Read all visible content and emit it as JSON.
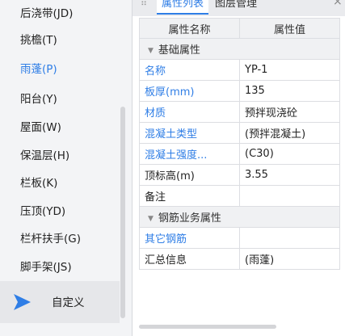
{
  "sidebar": {
    "items": [
      {
        "label": "后浇带(JD)",
        "active": false
      },
      {
        "label": "挑檐(T)",
        "active": false
      },
      {
        "label": "雨蓬(P)",
        "active": true
      },
      {
        "label": "阳台(Y)",
        "active": false
      },
      {
        "label": "屋面(W)",
        "active": false
      },
      {
        "label": "保温层(H)",
        "active": false
      },
      {
        "label": "栏板(K)",
        "active": false
      },
      {
        "label": "压顶(YD)",
        "active": false
      },
      {
        "label": "栏杆扶手(G)",
        "active": false
      },
      {
        "label": "脚手架(JS)",
        "active": false
      }
    ],
    "custom": {
      "label": "自定义",
      "icon": "play-icon"
    }
  },
  "panel": {
    "grip": "⠿",
    "tabs": [
      {
        "label": "属性列表",
        "active": true
      },
      {
        "label": "图层管理",
        "active": false
      }
    ],
    "close": "×",
    "table": {
      "headers": [
        "属性名称",
        "属性值"
      ],
      "groups": [
        {
          "title": "基础属性",
          "rows": [
            {
              "name": "名称",
              "value": "YP-1",
              "blue": true
            },
            {
              "name": "板厚(mm)",
              "value": "135",
              "blue": true
            },
            {
              "name": "材质",
              "value": "预拌现浇砼",
              "blue": true
            },
            {
              "name": "混凝土类型",
              "value": "(预拌混凝土)",
              "blue": true
            },
            {
              "name": "混凝土强度...",
              "value": "(C30)",
              "blue": true
            },
            {
              "name": "顶标高(m)",
              "value": "3.55",
              "blue": false
            },
            {
              "name": "备注",
              "value": "",
              "blue": false
            }
          ]
        },
        {
          "title": "钢筋业务属性",
          "rows": [
            {
              "name": "其它钢筋",
              "value": "",
              "blue": true
            },
            {
              "name": "汇总信息",
              "value": "(雨蓬)",
              "blue": false
            }
          ]
        }
      ]
    }
  },
  "colors": {
    "accent": "#2f7ee6",
    "sidebar_bg": "#f3f4f6",
    "grid_border": "#dcdee2"
  }
}
